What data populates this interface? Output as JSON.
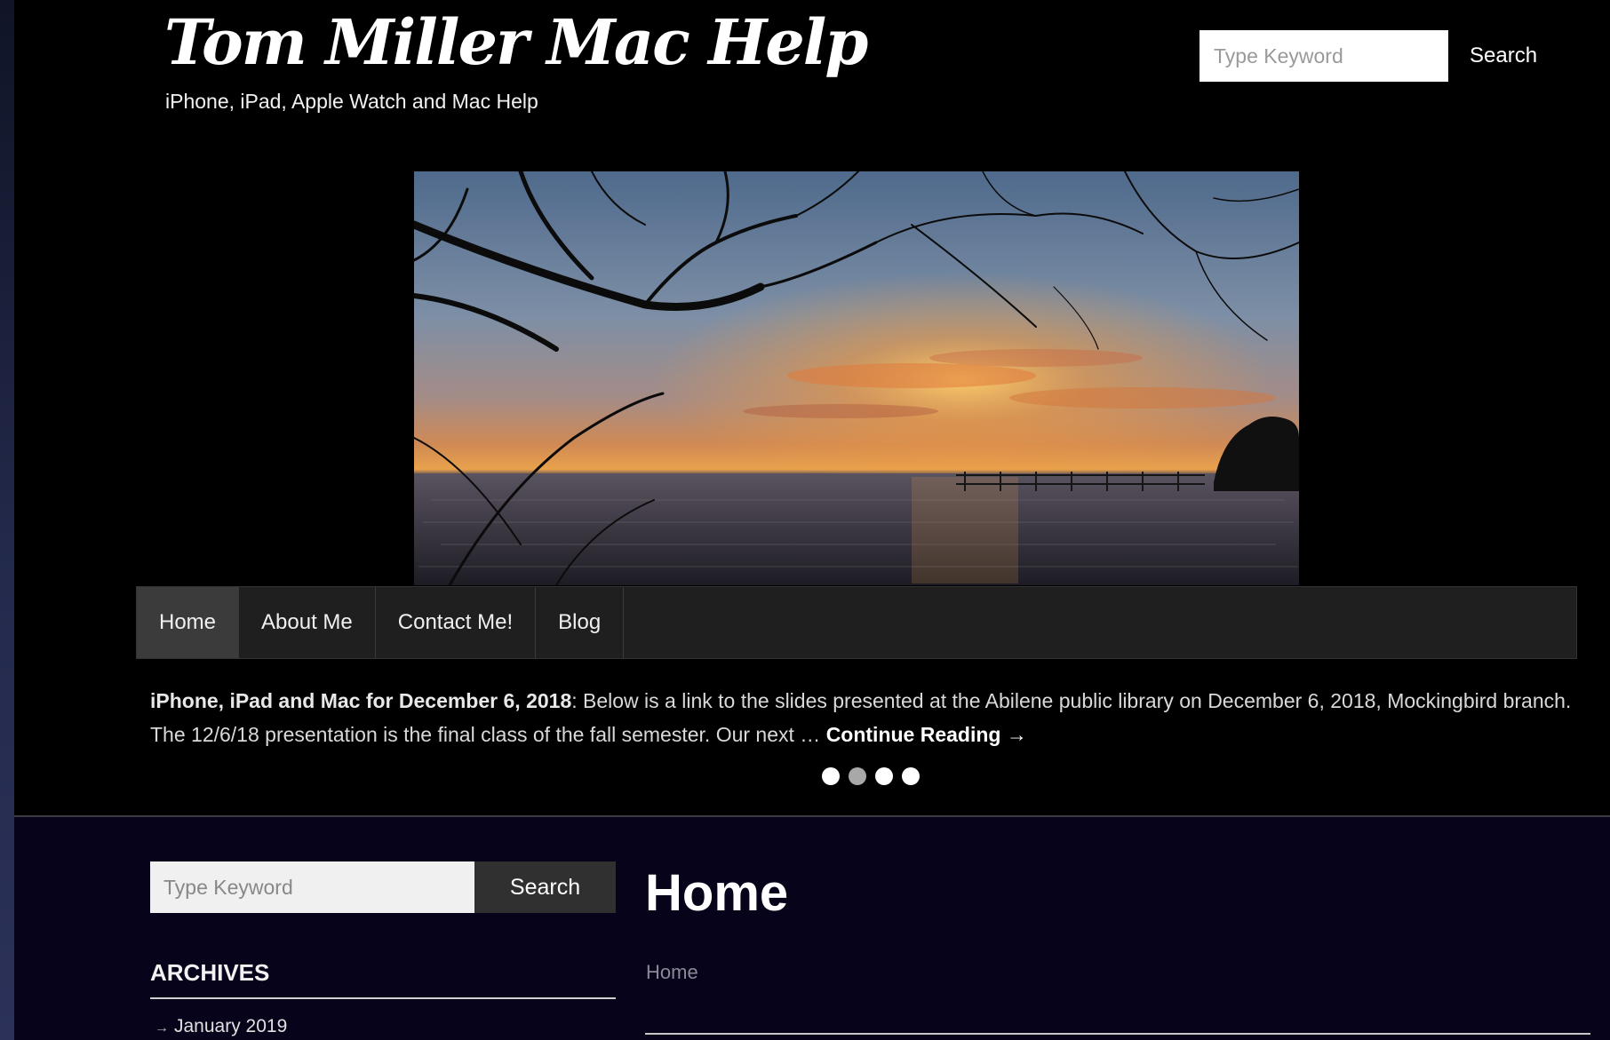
{
  "site": {
    "title": "Tom Miller Mac Help",
    "tagline": "iPhone, iPad, Apple Watch and Mac Help"
  },
  "top_search": {
    "placeholder": "Type Keyword",
    "button_label": "Search"
  },
  "nav": {
    "items": [
      {
        "label": "Home",
        "active": true
      },
      {
        "label": "About Me"
      },
      {
        "label": "Contact Me!"
      },
      {
        "label": "Blog"
      }
    ]
  },
  "slider": {
    "excerpt_title": "iPhone, iPad and Mac for December 6, 2018",
    "excerpt_text": ": Below is a link to the slides presented at the Abilene public library on December 6, 2018, Mockingbird branch.   The 12/6/18 presentation is the final class of the fall semester.  Our next … ",
    "continue_label": "Continue Reading →",
    "dot_count": 4,
    "active_dot": 2
  },
  "sidebar": {
    "search_placeholder": "Type Keyword",
    "search_button": "Search",
    "archives_heading": "ARCHIVES",
    "archives": [
      "January 2019"
    ]
  },
  "content": {
    "page_title": "Home",
    "breadcrumb": "Home"
  },
  "colors": {
    "header_bg": "#000000",
    "nav_bg": "#1f1f1f",
    "nav_active_bg": "#3b3b3b",
    "main_bg": "#06031a",
    "side_button_bg": "#303030"
  }
}
